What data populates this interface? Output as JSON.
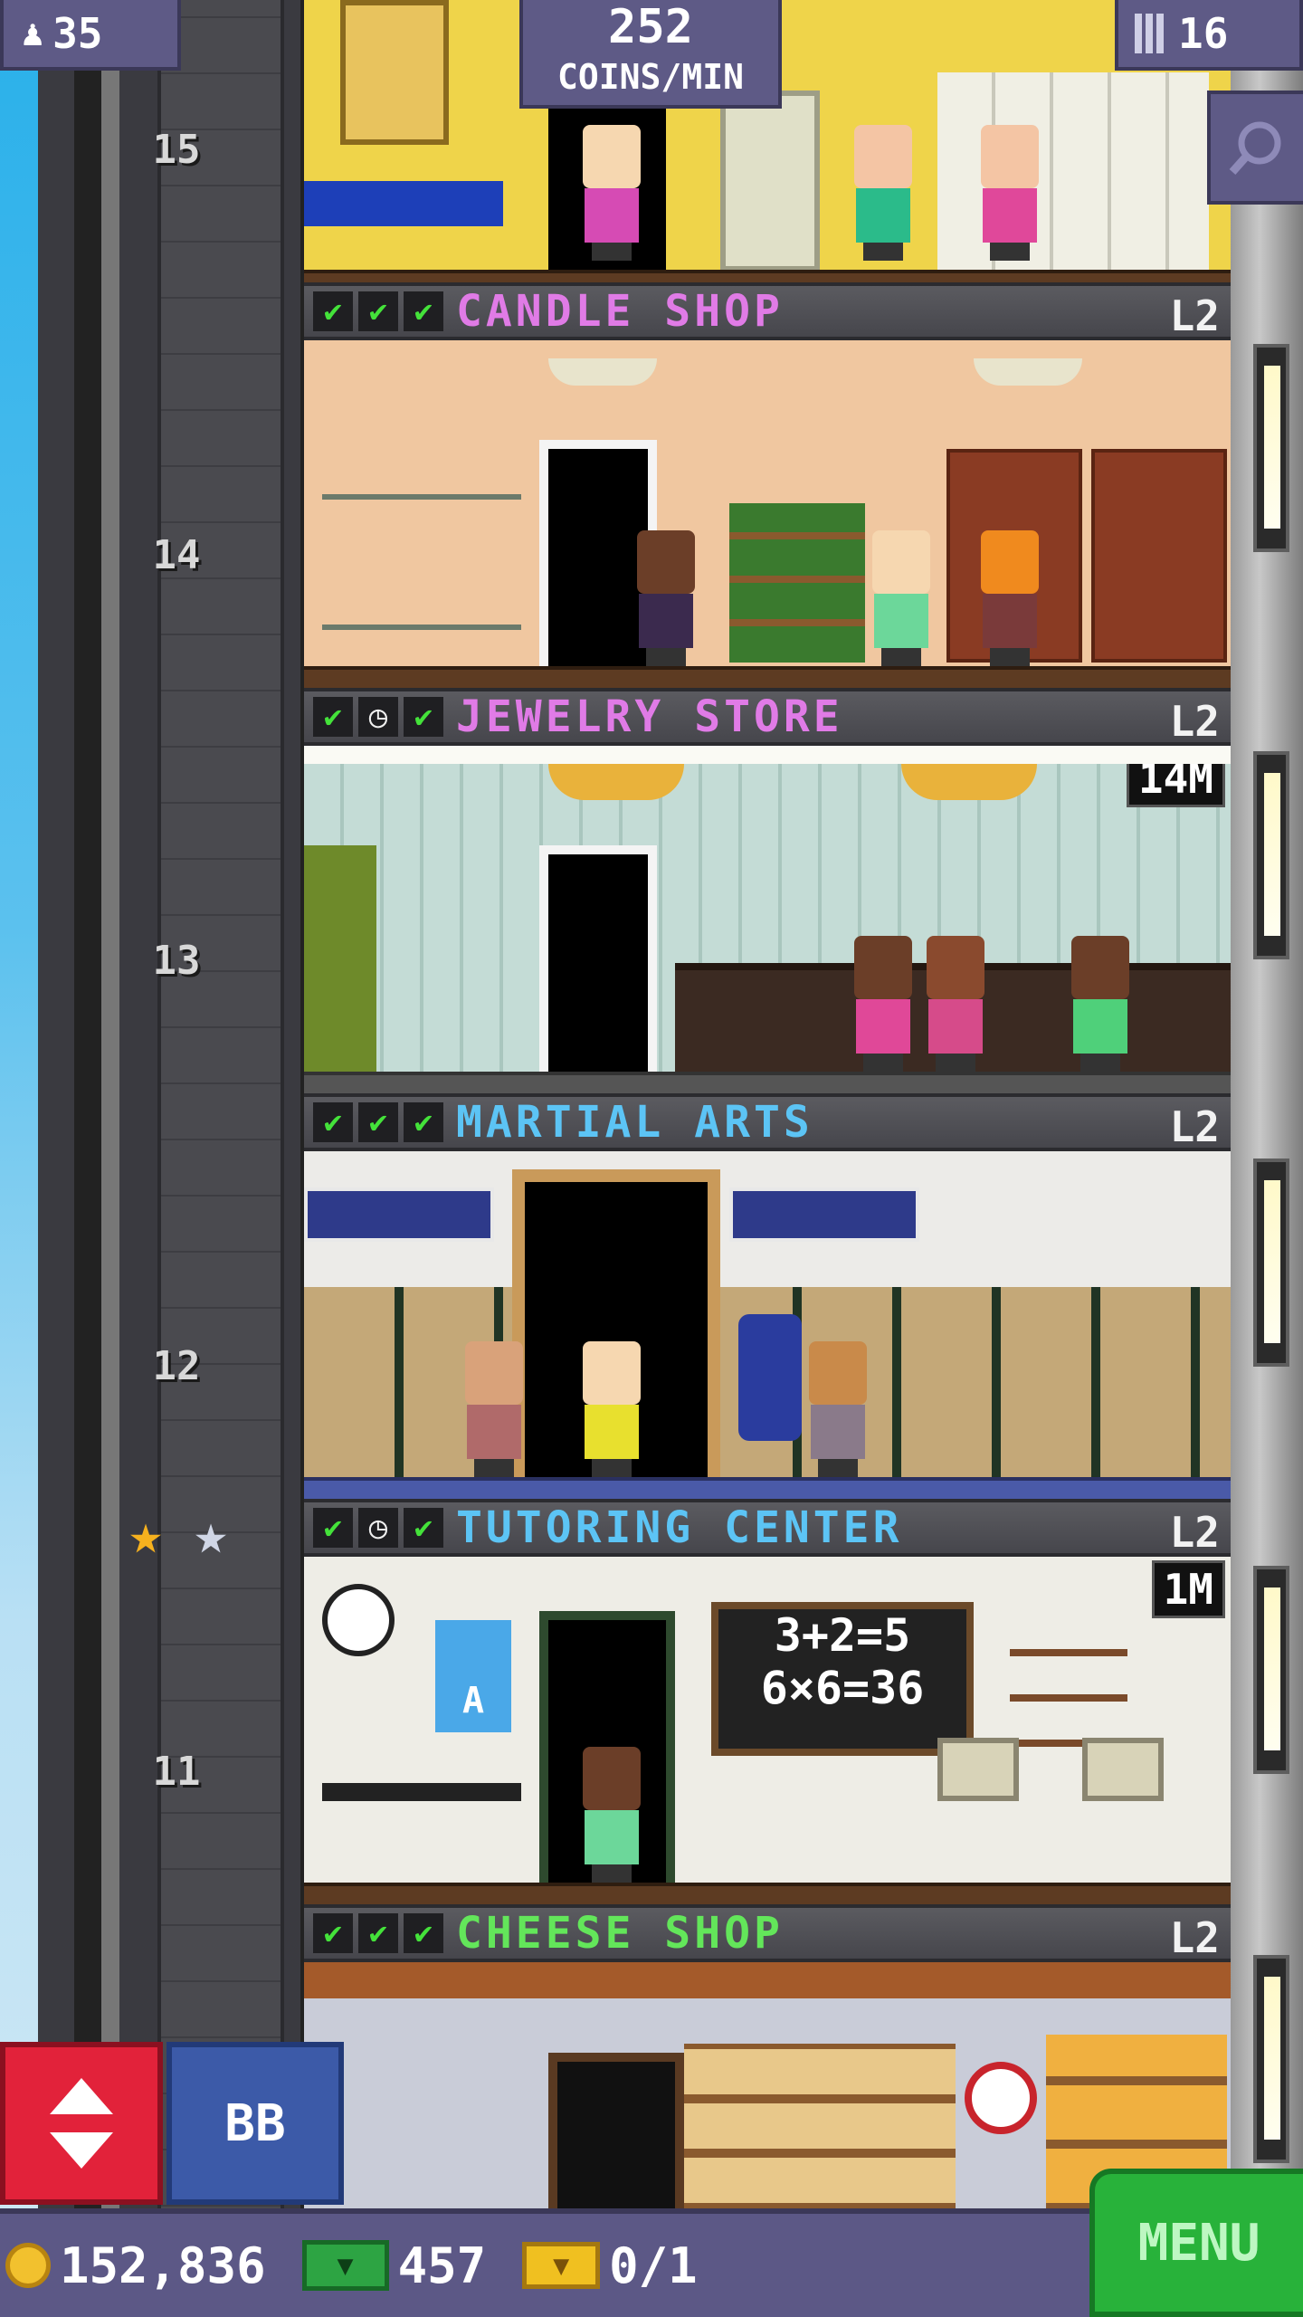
{
  "hud": {
    "population": "35",
    "coins_per_min_value": "252",
    "coins_per_min_unit": "COINS/MIN",
    "floors_count": "16"
  },
  "elevator": {
    "floor_numbers": [
      "15",
      "14",
      "13",
      "12",
      "11"
    ]
  },
  "floors": [
    {
      "name": "CANDLE SHOP",
      "level": "L2",
      "checks": [
        "check",
        "check",
        "check"
      ],
      "title_color": "#e07be6",
      "badge": ""
    },
    {
      "name": "JEWELRY STORE",
      "level": "L2",
      "checks": [
        "check",
        "clock",
        "check"
      ],
      "title_color": "#e07be6",
      "badge": "14M"
    },
    {
      "name": "MARTIAL ARTS",
      "level": "L2",
      "checks": [
        "check",
        "check",
        "check"
      ],
      "title_color": "#5cc4f5",
      "badge": ""
    },
    {
      "name": "TUTORING CENTER",
      "level": "L2",
      "checks": [
        "check",
        "clock",
        "check"
      ],
      "title_color": "#5cc4f5",
      "badge": "1M"
    },
    {
      "name": "CHEESE SHOP",
      "level": "L2",
      "checks": [
        "check",
        "check",
        "check"
      ],
      "title_color": "#63e65a",
      "badge": ""
    }
  ],
  "chalkboard": {
    "line1": "3+2=5",
    "line2": "6×6=36"
  },
  "poster_letter": "A",
  "buttons": {
    "bb_label": "BB",
    "menu_label": "MENU"
  },
  "currency": {
    "coins": "152,836",
    "bux": "457",
    "tickets": "0/1"
  },
  "icons": {
    "population": "person-icon",
    "floors": "building-icon",
    "search": "magnifier-icon",
    "elevator": "up-down-arrows-icon",
    "coin": "coin-icon",
    "bux": "cash-icon",
    "ticket": "ticket-icon"
  },
  "colors": {
    "hud_bg": "#5e5a86",
    "menu_bg": "#28b23a",
    "elevator_button": "#e2223a",
    "bb_button": "#3c5aa8"
  }
}
